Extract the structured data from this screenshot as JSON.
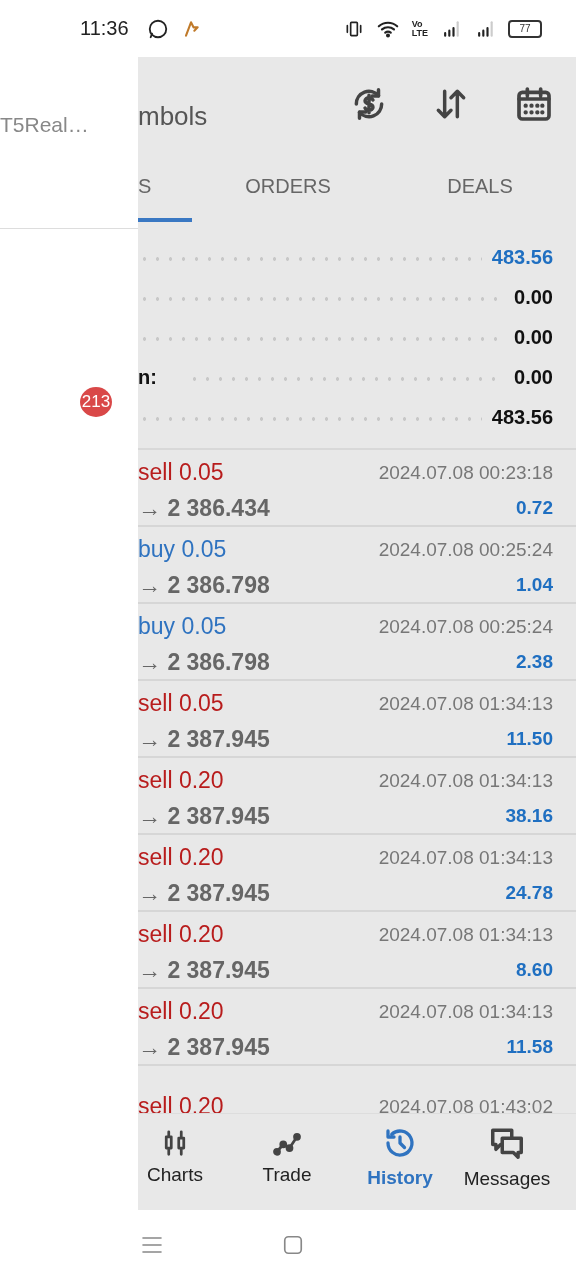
{
  "status_bar": {
    "time": "11:36",
    "volte": [
      "Vo",
      "LTE"
    ],
    "battery": "77"
  },
  "drawer": {
    "account": "T5Real…",
    "badge": "213"
  },
  "header": {
    "title": "mbols"
  },
  "tabs": [
    {
      "label": "S",
      "selected": true
    },
    {
      "label": "ORDERS",
      "selected": false
    },
    {
      "label": "DEALS",
      "selected": false
    }
  ],
  "summary": [
    {
      "value": "483.56",
      "highlight": true
    },
    {
      "value": "0.00",
      "highlight": false
    },
    {
      "value": "0.00",
      "highlight": false
    },
    {
      "label": "n:",
      "value": "0.00",
      "highlight": false
    },
    {
      "value": "483.56",
      "highlight": false
    }
  ],
  "deals": [
    {
      "kind": "sell",
      "title": "sell 0.05",
      "time": "2024.07.08 00:23:18",
      "price": "→ 2 386.434",
      "profit": "0.72"
    },
    {
      "kind": "buy",
      "title": "buy 0.05",
      "time": "2024.07.08 00:25:24",
      "price": "→ 2 386.798",
      "profit": "1.04"
    },
    {
      "kind": "buy",
      "title": "buy 0.05",
      "time": "2024.07.08 00:25:24",
      "price": "→ 2 386.798",
      "profit": "2.38"
    },
    {
      "kind": "sell",
      "title": "sell 0.05",
      "time": "2024.07.08 01:34:13",
      "price": "→ 2 387.945",
      "profit": "11.50"
    },
    {
      "kind": "sell",
      "title": "sell 0.20",
      "time": "2024.07.08 01:34:13",
      "price": "→ 2 387.945",
      "profit": "38.16"
    },
    {
      "kind": "sell",
      "title": "sell 0.20",
      "time": "2024.07.08 01:34:13",
      "price": "→ 2 387.945",
      "profit": "24.78"
    },
    {
      "kind": "sell",
      "title": "sell 0.20",
      "time": "2024.07.08 01:34:13",
      "price": "→ 2 387.945",
      "profit": "8.60"
    },
    {
      "kind": "sell",
      "title": "sell 0.20",
      "time": "2024.07.08 01:34:13",
      "price": "→ 2 387.945",
      "profit": "11.58"
    },
    {
      "kind": "sell",
      "title": "sell 0.20",
      "time": "2024.07.08 01:43:02"
    }
  ],
  "bottom_nav": [
    {
      "label": "Charts",
      "selected": false
    },
    {
      "label": "Trade",
      "selected": false
    },
    {
      "label": "History",
      "selected": true
    },
    {
      "label": "Messages",
      "selected": false
    }
  ]
}
